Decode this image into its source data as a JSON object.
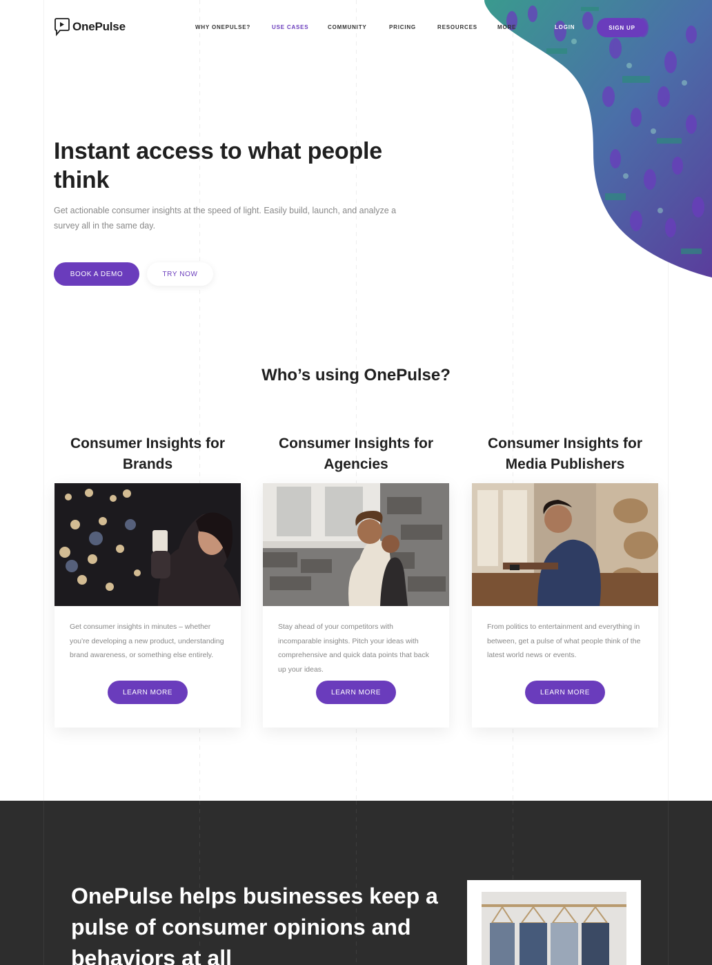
{
  "brand": {
    "name": "OnePulse",
    "accent": "#6a3cbc"
  },
  "nav": {
    "items": [
      {
        "label": "WHY ONEPULSE?",
        "active": false
      },
      {
        "label": "USE CASES",
        "active": true
      },
      {
        "label": "COMMUNITY",
        "active": false
      },
      {
        "label": "PRICING",
        "active": false
      },
      {
        "label": "RESOURCES",
        "active": false
      },
      {
        "label": "MORE",
        "active": false
      }
    ],
    "login": "LOGIN",
    "signup": "SIGN UP"
  },
  "hero": {
    "title": "Instant access to what people think",
    "subtitle": "Get actionable consumer insights at the speed of light. Easily build, launch, and analyze a survey all in the same day.",
    "primary_button": "BOOK A DEMO",
    "secondary_button": "TRY NOW"
  },
  "who": {
    "title": "Who’s using OnePulse?",
    "cards": [
      {
        "heading": "Consumer Insights for Brands",
        "text": "Get consumer insights in minutes – whether you’re developing a new product, understanding brand awareness, or something else entirely.",
        "button": "LEARN MORE"
      },
      {
        "heading": "Consumer Insights for Agencies",
        "text": "Stay ahead of your competitors with incomparable insights. Pitch your ideas with comprehensive and quick data points that back up your ideas.",
        "button": "LEARN MORE"
      },
      {
        "heading": "Consumer Insights for Media Publishers",
        "text": "From politics to entertainment and everything in between, get a pulse of what people think of the latest world news or events.",
        "button": "LEARN MORE"
      }
    ]
  },
  "business": {
    "title": "OnePulse helps businesses keep a pulse of consumer opinions and behaviors at all"
  },
  "icons": {
    "logo": "speech-bubble-play-icon"
  }
}
